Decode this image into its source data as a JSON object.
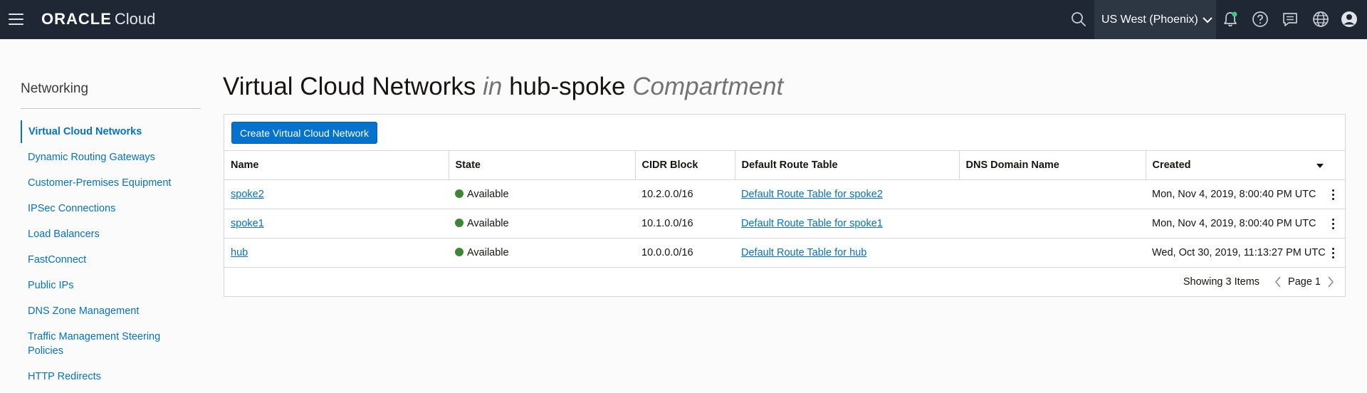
{
  "topbar": {
    "brand": "ORACLE",
    "product": "Cloud",
    "region": "US West (Phoenix)"
  },
  "sidebar": {
    "title": "Networking",
    "items": [
      {
        "label": "Virtual Cloud Networks",
        "active": true
      },
      {
        "label": "Dynamic Routing Gateways"
      },
      {
        "label": "Customer-Premises Equipment"
      },
      {
        "label": "IPSec Connections"
      },
      {
        "label": "Load Balancers"
      },
      {
        "label": "FastConnect"
      },
      {
        "label": "Public IPs"
      },
      {
        "label": "DNS Zone Management"
      },
      {
        "label": "Traffic Management Steering Policies"
      },
      {
        "label": "HTTP Redirects"
      }
    ]
  },
  "main": {
    "title_prefix": "Virtual Cloud Networks",
    "title_in": "in",
    "compartment": "hub-spoke",
    "title_suffix": "Compartment",
    "create_button": "Create Virtual Cloud Network",
    "columns": [
      "Name",
      "State",
      "CIDR Block",
      "Default Route Table",
      "DNS Domain Name",
      "Created"
    ],
    "rows": [
      {
        "name": "spoke2",
        "state": "Available",
        "cidr": "10.2.0.0/16",
        "route_table": "Default Route Table for spoke2",
        "dns": "",
        "created": "Mon, Nov 4, 2019, 8:00:40 PM UTC"
      },
      {
        "name": "spoke1",
        "state": "Available",
        "cidr": "10.1.0.0/16",
        "route_table": "Default Route Table for spoke1",
        "dns": "",
        "created": "Mon, Nov 4, 2019, 8:00:40 PM UTC"
      },
      {
        "name": "hub",
        "state": "Available",
        "cidr": "10.0.0.0/16",
        "route_table": "Default Route Table for hub",
        "dns": "",
        "created": "Wed, Oct 30, 2019, 11:13:27 PM UTC"
      }
    ],
    "pagination": {
      "showing": "Showing 3 Items",
      "page": "Page 1"
    }
  },
  "colors": {
    "topbar_bg": "#1e2733",
    "accent": "#0572ce",
    "link": "#0571c7",
    "status_available": "#3e8635",
    "notification_dot": "#36c98a"
  },
  "icons": [
    "menu-icon",
    "search-icon",
    "chevron-down-icon",
    "bell-icon",
    "help-icon",
    "chat-icon",
    "globe-icon",
    "user-icon",
    "more-vertical-icon",
    "chevron-left-icon",
    "chevron-right-icon",
    "sort-desc-icon"
  ]
}
